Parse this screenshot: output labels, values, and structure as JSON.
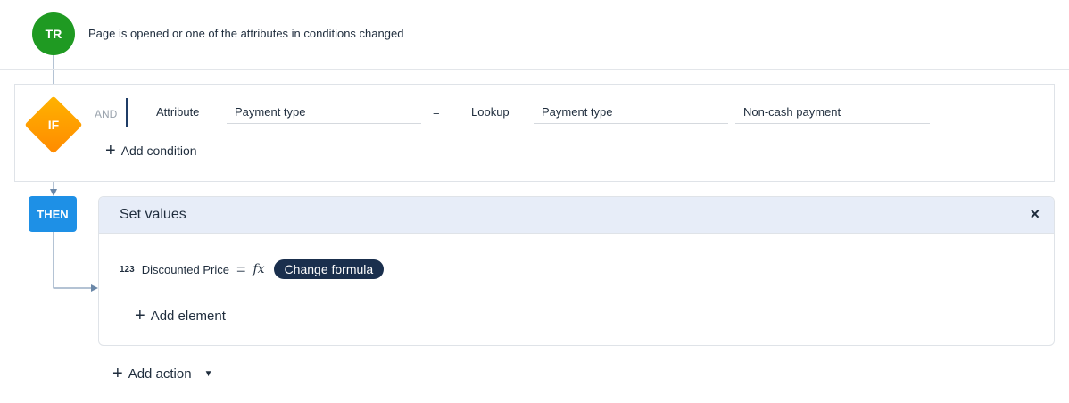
{
  "trigger": {
    "badge": "TR",
    "text": "Page is opened or one of the attributes in conditions changed"
  },
  "condition": {
    "badge": "IF",
    "operator": "AND",
    "row": {
      "left_type": "Attribute",
      "left_value": "Payment type",
      "comparator": "=",
      "right_type": "Lookup",
      "right_lookup": "Payment type",
      "right_value": "Non-cash payment"
    },
    "add_label": "Add condition"
  },
  "then": {
    "badge": "THEN",
    "action_title": "Set values",
    "close_icon": "×",
    "assignment": {
      "type_icon": "123",
      "attribute": "Discounted Price",
      "equals": "=",
      "fx": "fx",
      "formula_button": "Change formula"
    },
    "add_element_label": "Add element"
  },
  "add_action_label": "Add action",
  "colors": {
    "trigger": "#1f9a22",
    "condition": "#ff9800",
    "then": "#1e90e6",
    "formula_pill": "#1a2f4d",
    "header_bg": "#e7edf8"
  }
}
